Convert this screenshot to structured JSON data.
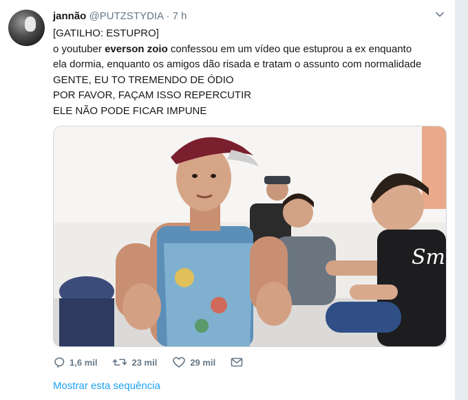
{
  "tweet": {
    "fullname": "jannão",
    "handle": "@PUTZSTYDIA",
    "separator": "·",
    "time": "7 h",
    "lines": [
      "[GATILHO: ESTUPRO]",
      {
        "pre": "o youtuber ",
        "bold": "everson zoio",
        "post": " confessou em um vídeo que estuprou a ex enquanto"
      },
      "ela dormia, enquanto os amigos dão risada e tratam o assunto com normalidade",
      "GENTE, EU TO TREMENDO DE ÓDIO",
      "POR FAVOR, FAÇAM ISSO REPERCUTIR",
      "ELE NÃO PODE FICAR IMPUNE"
    ],
    "actions": {
      "reply_count": "1,6 mil",
      "retweet_count": "23 mil",
      "like_count": "29 mil"
    },
    "show_thread": "Mostrar esta sequência"
  },
  "icons": {
    "menu": "chevron-down-icon",
    "reply": "reply-icon",
    "retweet": "retweet-icon",
    "like": "heart-icon",
    "message": "envelope-icon"
  },
  "colors": {
    "link": "#1da1f2",
    "muted": "#657786",
    "text": "#14171a",
    "rail": "#e6ecf0"
  }
}
